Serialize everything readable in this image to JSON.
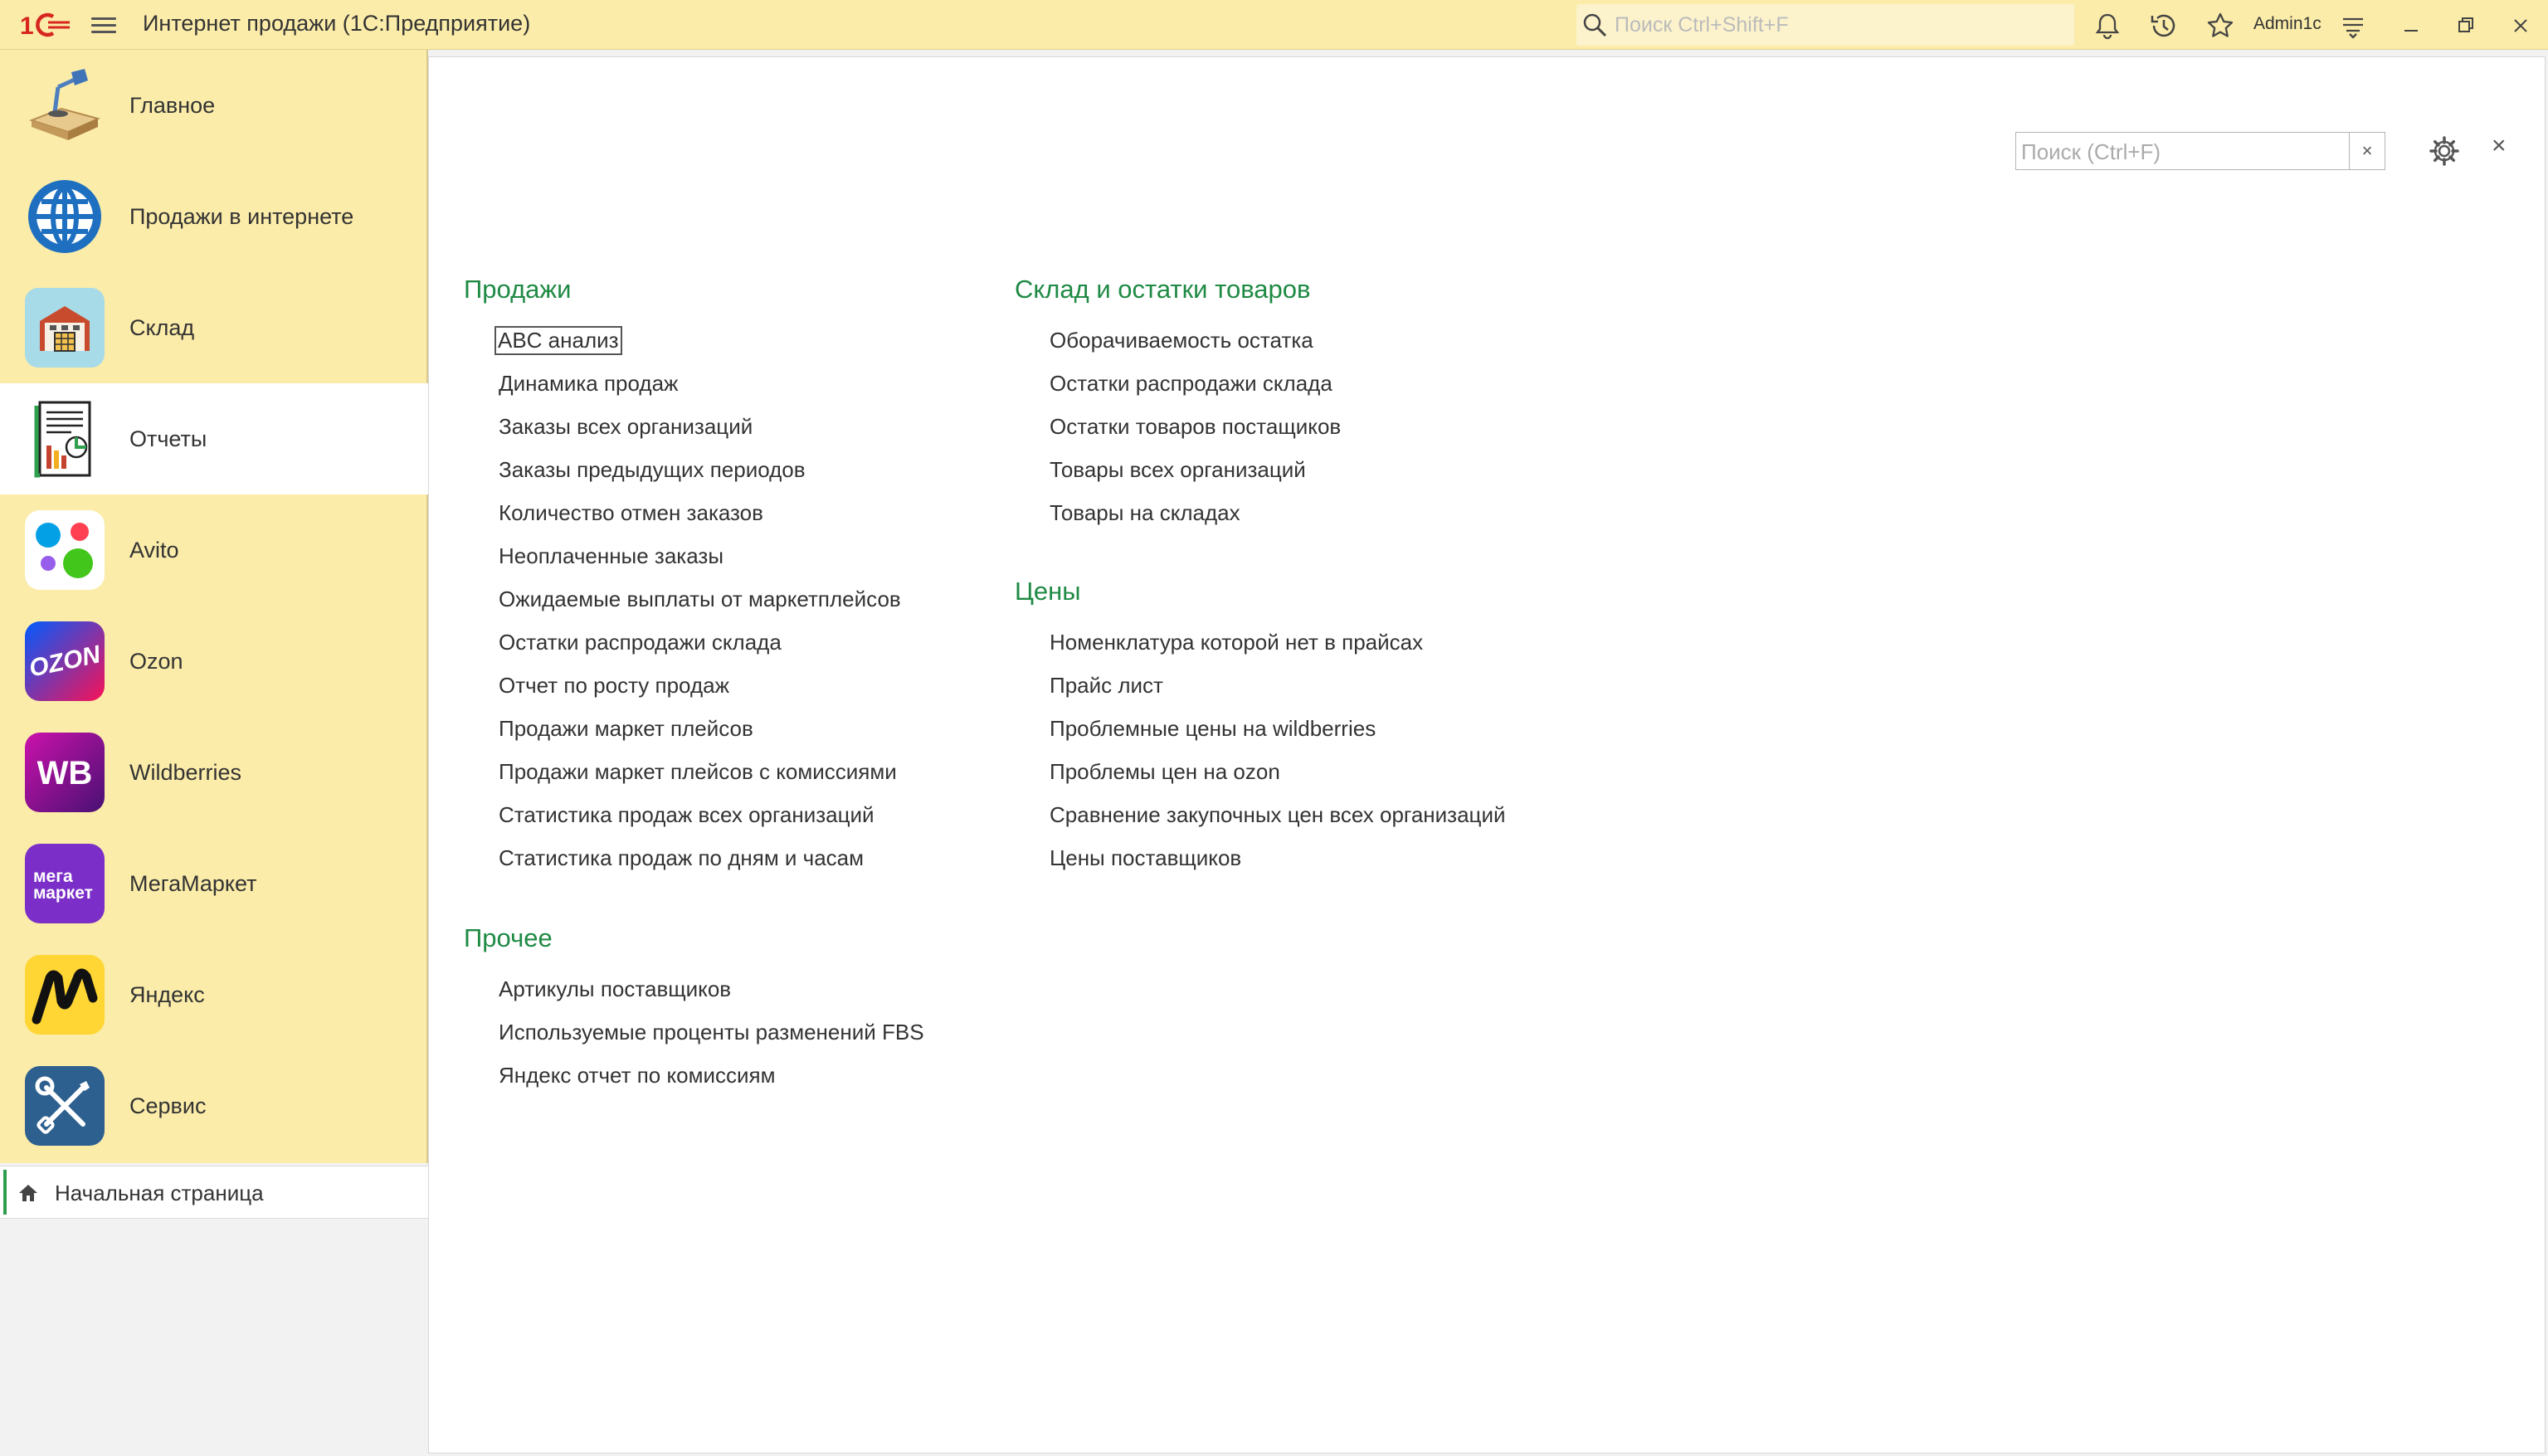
{
  "titlebar": {
    "app_title": "Интернет продажи  (1С:Предприятие)",
    "search_placeholder": "Поиск Ctrl+Shift+F",
    "user": "Admin1c"
  },
  "sidebar": {
    "sections": [
      {
        "label": "Главное",
        "icon": "desk-lamp-icon"
      },
      {
        "label": "Продажи в интернете",
        "icon": "globe-icon"
      },
      {
        "label": "Склад",
        "icon": "warehouse-icon"
      },
      {
        "label": "Отчеты",
        "icon": "report-icon"
      },
      {
        "label": "Avito",
        "icon": "avito-icon"
      },
      {
        "label": "Ozon",
        "icon": "ozon-icon"
      },
      {
        "label": "Wildberries",
        "icon": "wildberries-icon"
      },
      {
        "label": "МегаМаркет",
        "icon": "megamarket-icon"
      },
      {
        "label": "Яндекс",
        "icon": "yandex-icon"
      },
      {
        "label": "Сервис",
        "icon": "service-tools-icon"
      }
    ],
    "active_section": "Отчеты",
    "home_tab": "Начальная страница",
    "icon_text": {
      "wb": "WB",
      "mega_1": "мега",
      "mega_2": "маркет",
      "ozon": "OZON"
    }
  },
  "main": {
    "search_placeholder": "Поиск (Ctrl+F)",
    "clear_label": "×",
    "close_label": "×",
    "groups": {
      "sales": {
        "title": "Продажи",
        "items": [
          "ABC анализ",
          "Динамика продаж",
          "Заказы всех организаций",
          "Заказы предыдущих периодов",
          "Количество отмен заказов",
          "Неоплаченные заказы",
          "Ожидаемые выплаты от маркетплейсов",
          "Остатки распродажи склада",
          "Отчет по росту продаж",
          "Продажи маркет плейсов",
          "Продажи маркет плейсов с комиссиями",
          "Статистика продаж всех организаций",
          "Статистика продаж по дням и часам"
        ]
      },
      "other": {
        "title": "Прочее",
        "items": [
          "Артикулы поставщиков",
          "Используемые проценты разменений FBS",
          "Яндекс отчет по комиссиям"
        ]
      },
      "stock": {
        "title": "Склад и остатки товаров",
        "items": [
          "Оборачиваемость остатка",
          "Остатки распродажи склада",
          "Остатки товаров постащиков",
          "Товары всех организаций",
          "Товары на складах"
        ]
      },
      "prices": {
        "title": "Цены",
        "items": [
          "Номенклатура которой нет в прайсах",
          "Прайс лист",
          "Проблемные цены на wildberries",
          "Проблемы цен на ozon",
          "Сравнение закупочных цен всех организаций",
          "Цены поставщиков"
        ]
      }
    }
  },
  "colors": {
    "titlebar_bg": "#fbeca9",
    "group_title": "#1f8a44",
    "accent_red": "#d7261e",
    "active_tab_bar": "#2e9d4c"
  }
}
